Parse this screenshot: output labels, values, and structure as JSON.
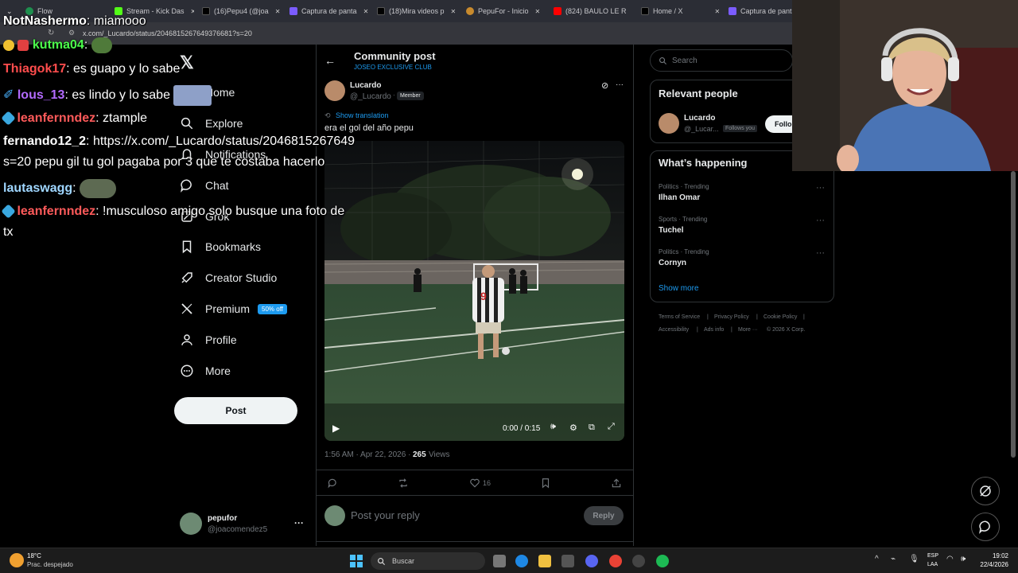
{
  "browser": {
    "tabs": [
      {
        "label": "Flow",
        "color": "#1e8f4e"
      },
      {
        "label": "Stream - Kick Das",
        "color": "#53fc18"
      },
      {
        "label": "(16)Pepu4 (@joa",
        "color": "#111111"
      },
      {
        "label": "Captura de panta",
        "color": "#7b5cff"
      },
      {
        "label": "(18)Mira videos p",
        "color": "#111111"
      },
      {
        "label": "PepuFor - Inicio",
        "color": "#c88a2d"
      },
      {
        "label": "(824) BAULO LE R",
        "color": "#ff0000"
      },
      {
        "label": "Home / X",
        "color": "#111111"
      },
      {
        "label": "Captura de panta",
        "color": "#7b5cff"
      }
    ],
    "url": "x.com/_Lucardo/status/2046815267649376681?s=20"
  },
  "chat": [
    {
      "user": "NotNashermo",
      "message": "miamooo",
      "color": "#ffffff"
    },
    {
      "user": "kutma04",
      "message": "",
      "color": "#4cff4c"
    },
    {
      "user": "Thiagok17",
      "message": "es guapo y lo sabe",
      "color": "#ff4d4d"
    },
    {
      "user": "lous_13",
      "message": "es lindo y lo sabe",
      "color": "#b36bff"
    },
    {
      "user": "leanfernndez",
      "message": "ztample",
      "color": "#ff5a5a"
    },
    {
      "user": "fernando12_2",
      "message": "https://x.com/_Lucardo/status/2046815267649",
      "color": "#ffffff"
    },
    {
      "user": "",
      "message": "s=20 pepu gil tu gol pagaba por 3 que te costaba hacerlo",
      "color": "#ffffff"
    },
    {
      "user": "lautaswagg",
      "message": "",
      "color": "#9fd6ff"
    },
    {
      "user": "leanfernndez",
      "message": "!musculoso amigo solo busque una foto de",
      "color": "#ff5a5a"
    },
    {
      "user": "",
      "message": "tx",
      "color": "#ffffff"
    }
  ],
  "nav": {
    "items": [
      "Home",
      "Explore",
      "Notifications",
      "Chat",
      "Grok",
      "Bookmarks",
      "Creator Studio",
      "Premium",
      "Profile",
      "More"
    ],
    "premium_badge": "50% off",
    "post_label": "Post",
    "account_name": "pepufor",
    "account_handle": "@joacomendez5"
  },
  "post": {
    "header_title": "Community post",
    "header_sub": "JOSEO EXCLUSIVE CLUB",
    "author_name": "Lucardo",
    "author_handle": "@_Lucardo",
    "member_badge": "Member",
    "show_translation": "Show translation",
    "text": "era el gol del año pepu",
    "video_time": "0:00 / 0:15",
    "jersey_number": "9",
    "timestamp": "1:56 AM · Apr 22, 2026 ·",
    "views_count": "265",
    "views_label": "Views",
    "likes": "16",
    "reply_placeholder": "Post your reply",
    "reply_button": "Reply"
  },
  "right": {
    "search_placeholder": "Search",
    "relevant_title": "Relevant people",
    "person_name": "Lucardo",
    "person_handle": "@_Lucar...",
    "follows_you": "Follows you",
    "follow_label": "Follo",
    "happening_title": "What’s happening",
    "trends": [
      {
        "category": "Politics · Trending",
        "name": "Ilhan Omar"
      },
      {
        "category": "Sports · Trending",
        "name": "Tuchel"
      },
      {
        "category": "Politics · Trending",
        "name": "Cornyn"
      }
    ],
    "show_more": "Show more",
    "footer_row1": [
      "Terms of Service",
      "Privacy Policy",
      "Cookie Policy"
    ],
    "footer_row2": [
      "Accessibility",
      "Ads info",
      "More ···",
      "© 2026 X Corp."
    ]
  },
  "taskbar": {
    "weather_temp": "18°C",
    "weather_desc": "Prac. despejado",
    "search_label": "Buscar",
    "lang": "ESP",
    "lang2": "LAA",
    "time": "19:02",
    "date": "22/4/2026"
  }
}
